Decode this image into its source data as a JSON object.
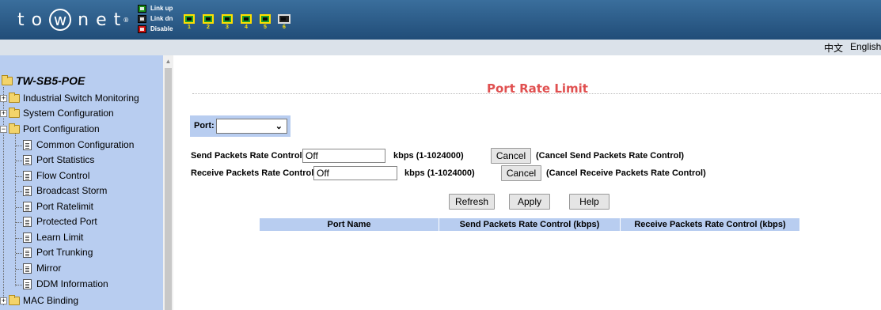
{
  "header": {
    "logo_text": "to w net",
    "logo_letters": [
      "t",
      "o",
      "w",
      "n",
      "e",
      "t"
    ],
    "legend": [
      {
        "label": "Link up",
        "status": "up"
      },
      {
        "label": "Link dn",
        "status": "dn"
      },
      {
        "label": "Disable",
        "status": "dis"
      }
    ],
    "ports": [
      "1",
      "2",
      "3",
      "4",
      "5",
      "6"
    ]
  },
  "lang": {
    "chinese": "中文",
    "english": "English"
  },
  "sidebar": {
    "root": "TW-SB5-POE",
    "items": [
      {
        "label": "Industrial Switch Monitoring",
        "type": "folder"
      },
      {
        "label": "System Configuration",
        "type": "folder"
      },
      {
        "label": "Port Configuration",
        "type": "folder-open"
      },
      {
        "label": "Common Configuration",
        "type": "page"
      },
      {
        "label": "Port Statistics",
        "type": "page"
      },
      {
        "label": "Flow Control",
        "type": "page"
      },
      {
        "label": "Broadcast Storm",
        "type": "page"
      },
      {
        "label": "Port Ratelimit",
        "type": "page"
      },
      {
        "label": "Protected Port",
        "type": "page"
      },
      {
        "label": "Learn Limit",
        "type": "page"
      },
      {
        "label": "Port Trunking",
        "type": "page"
      },
      {
        "label": "Mirror",
        "type": "page"
      },
      {
        "label": "DDM Information",
        "type": "page"
      },
      {
        "label": "MAC Binding",
        "type": "folder"
      }
    ]
  },
  "main": {
    "title": "Port Rate Limit",
    "port_label": "Port:",
    "port_value": "",
    "send": {
      "label": "Send Packets Rate Control",
      "value": "Off",
      "range": "kbps (1-1024000)",
      "cancel": "Cancel",
      "cancel_note": "(Cancel Send Packets Rate Control)"
    },
    "receive": {
      "label": "Receive Packets Rate Control",
      "value": "Off",
      "range": "kbps (1-1024000)",
      "cancel": "Cancel",
      "cancel_note": "(Cancel Receive Packets Rate Control)"
    },
    "buttons": {
      "refresh": "Refresh",
      "apply": "Apply",
      "help": "Help"
    },
    "table_headers": [
      "Port Name",
      "Send Packets Rate Control (kbps)",
      "Receive Packets Rate Control (kbps)"
    ]
  }
}
